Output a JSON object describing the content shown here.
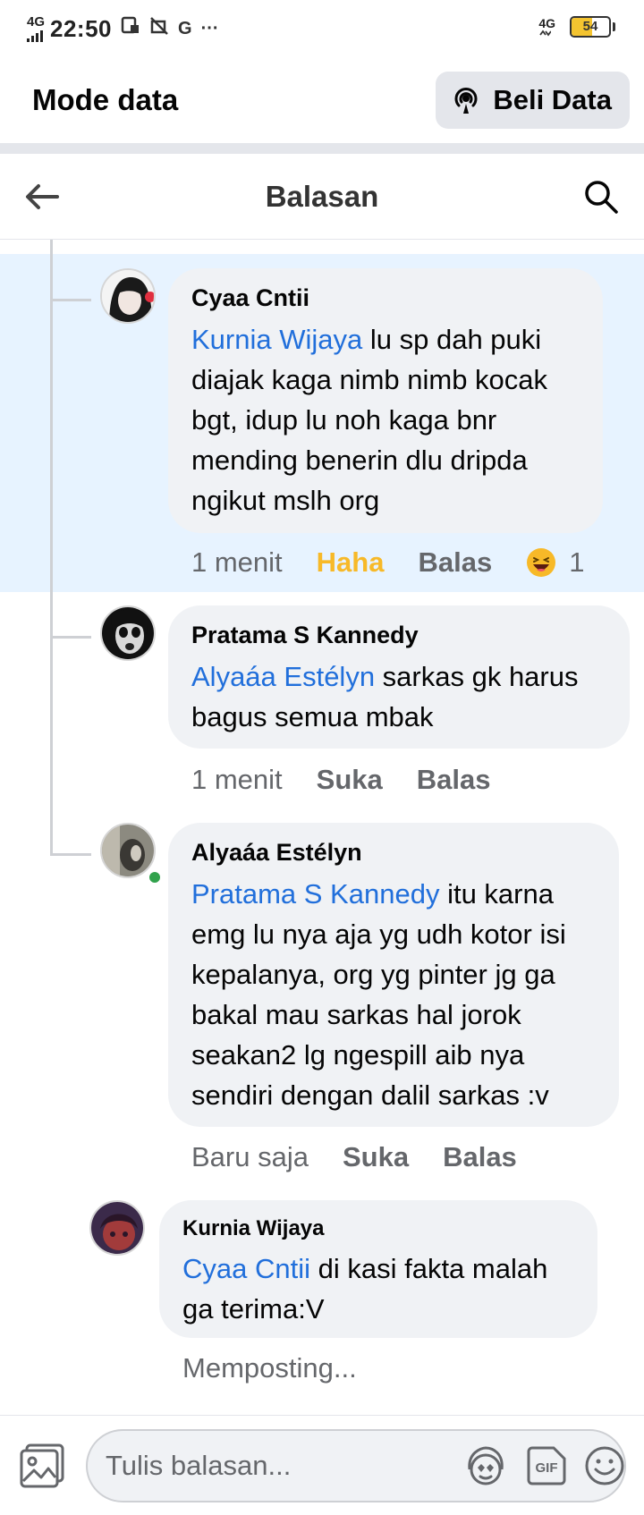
{
  "status_bar": {
    "network_left": "4G",
    "time": "22:50",
    "carrier_letter": "G",
    "more": "···",
    "network_right": "4G",
    "battery": "54",
    "battery_level": 0.54
  },
  "data_mode": {
    "title": "Mode data",
    "buy_label": "Beli Data"
  },
  "header": {
    "title": "Balasan"
  },
  "comments": [
    {
      "name": "Cyaa Cntii",
      "mention": "Kurnia Wijaya",
      "text": " lu sp dah puki diajak kaga nimb nimb kocak bgt, idup lu noh kaga bnr mending benerin dlu dripda ngikut mslh org",
      "time": "1 menit",
      "reaction_label": "Haha",
      "reply_label": "Balas",
      "reaction_count": "1"
    },
    {
      "name": "Pratama S Kannedy",
      "mention": "Alyaáa Estélyn",
      "text": " sarkas gk harus bagus semua mbak",
      "time": "1 menit",
      "reaction_label": "Suka",
      "reply_label": "Balas"
    },
    {
      "name": "Alyaáa Estélyn",
      "mention": "Pratama S Kannedy",
      "text": " itu karna emg lu nya aja yg udh kotor isi kepalanya, org yg pinter jg ga bakal mau sarkas hal jorok seakan2 lg ngespill aib nya sendiri dengan dalil sarkas :v",
      "time": "Baru saja",
      "reaction_label": "Suka",
      "reply_label": "Balas"
    },
    {
      "name": "Kurnia Wijaya",
      "mention": "Cyaa Cntii",
      "text": " di kasi fakta malah ga terima:V",
      "status": "Memposting..."
    }
  ],
  "composer": {
    "placeholder": "Tulis balasan..."
  },
  "colors": {
    "accent": "#216fdb",
    "haha": "#f7b928",
    "highlight": "#e7f3ff",
    "bubble": "#f0f2f5"
  },
  "icons": [
    "back-arrow-icon",
    "search-icon",
    "broadcast-icon",
    "photo-icon",
    "avatar-sticker-icon",
    "gif-icon",
    "emoji-icon",
    "haha-reaction-icon"
  ]
}
